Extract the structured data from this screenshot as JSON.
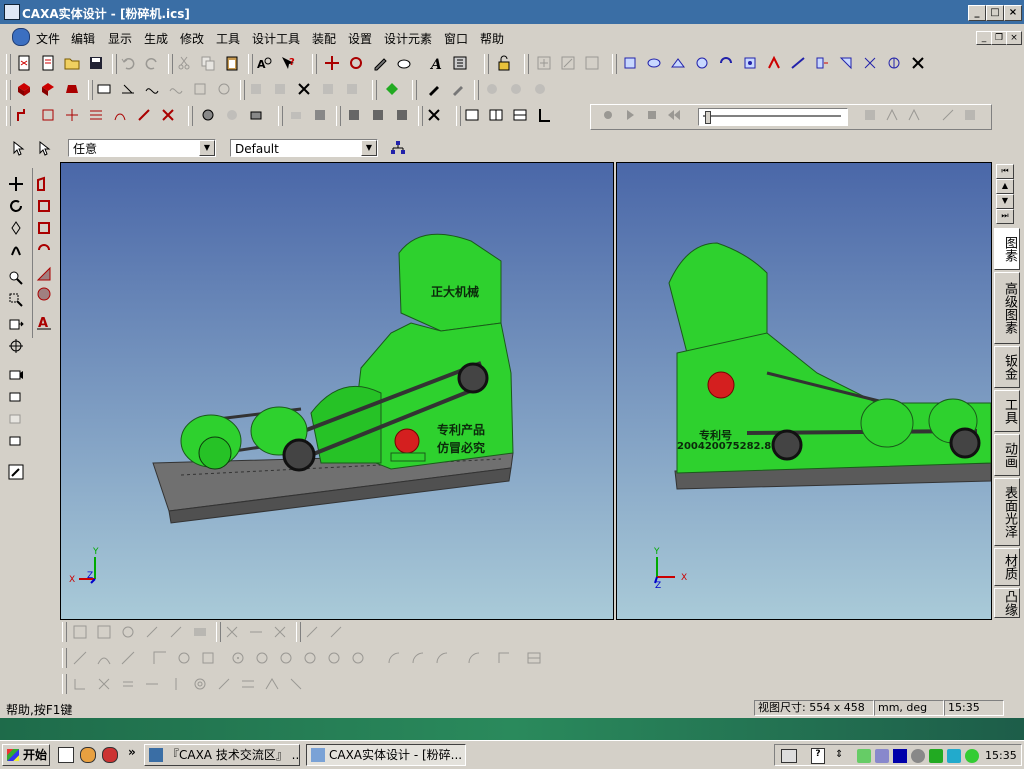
{
  "window": {
    "title": "CAXA实体设计 - [粉碎机.ics]"
  },
  "menu": [
    "文件",
    "编辑",
    "显示",
    "生成",
    "修改",
    "工具",
    "设计工具",
    "装配",
    "设置",
    "设计元素",
    "窗口",
    "帮助"
  ],
  "selector": {
    "filter_value": "任意",
    "style_value": "Default"
  },
  "viewport_left": {
    "label_top": "正大机械",
    "label_patent_1": "专利产品",
    "label_patent_2": "仿冒必究",
    "axes": {
      "x": "X",
      "y": "Y",
      "z": "Z"
    }
  },
  "viewport_right": {
    "label_patent_no_title": "专利号",
    "label_patent_no": "200420075282.8",
    "axes": {
      "x": "X",
      "y": "Y",
      "z": "Z"
    }
  },
  "right_tabs": [
    "图素",
    "高级图素",
    "钣金",
    "工具",
    "动画",
    "表面光泽",
    "材质",
    "凸缘"
  ],
  "status": {
    "help": "帮助,按F1键",
    "view_size": "视图尺寸: 554 x 458",
    "units": "mm, deg",
    "time": "15:35"
  },
  "taskbar": {
    "start": "开始",
    "tasks": [
      "『CAXA 技术交流区』 ...",
      "CAXA实体设计 - [粉碎..."
    ],
    "clock": "15:35"
  },
  "icons": [
    "minimize-icon",
    "maximize-icon",
    "close-icon",
    "arrow-pointer-icon",
    "dropdown-arrow-icon"
  ]
}
